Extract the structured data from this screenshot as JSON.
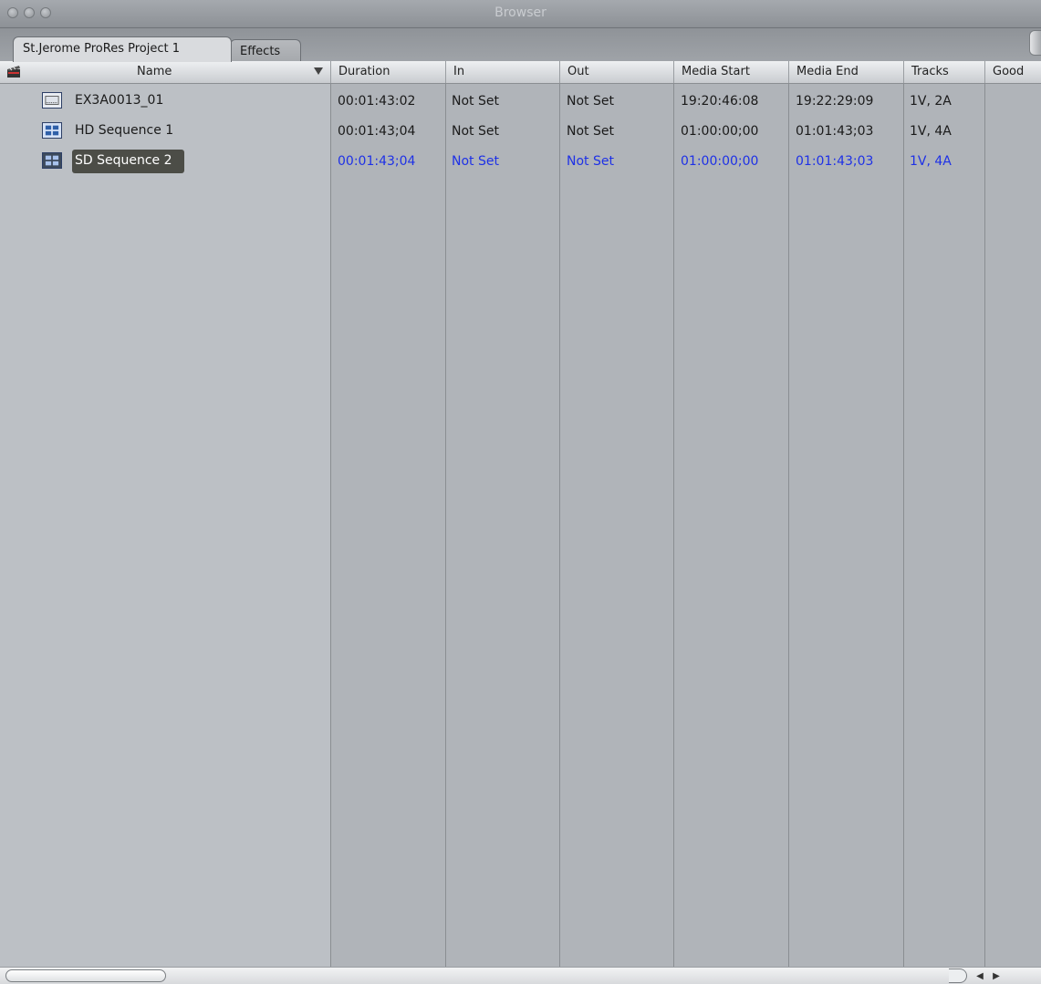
{
  "window": {
    "title": "Browser"
  },
  "tabs": [
    {
      "label": "St.Jerome ProRes Project 1",
      "active": true
    },
    {
      "label": "Effects",
      "active": false
    }
  ],
  "columns": [
    "Name",
    "Duration",
    "In",
    "Out",
    "Media Start",
    "Media End",
    "Tracks",
    "Good"
  ],
  "rows": [
    {
      "icon": "clip-icon",
      "name": "EX3A0013_01",
      "duration": "00:01:43:02",
      "in": "Not Set",
      "out": "Not Set",
      "media_start": "19:20:46:08",
      "media_end": "19:22:29:09",
      "tracks": "1V, 2A",
      "selected": false
    },
    {
      "icon": "sequence-icon",
      "name": "HD Sequence 1",
      "duration": "00:01:43;04",
      "in": "Not Set",
      "out": "Not Set",
      "media_start": "01:00:00;00",
      "media_end": "01:01:43;03",
      "tracks": "1V, 4A",
      "selected": false
    },
    {
      "icon": "sequence-icon",
      "name": "SD Sequence 2",
      "duration": "00:01:43;04",
      "in": "Not Set",
      "out": "Not Set",
      "media_start": "01:00:00;00",
      "media_end": "01:01:43;03",
      "tracks": "1V, 4A",
      "selected": true
    }
  ],
  "colors": {
    "selected_text": "#1e31e6",
    "selected_name_bg": "#4c4d47",
    "name_column_bg": "#bcc0c5",
    "data_column_bg": "#b0b4b9"
  }
}
